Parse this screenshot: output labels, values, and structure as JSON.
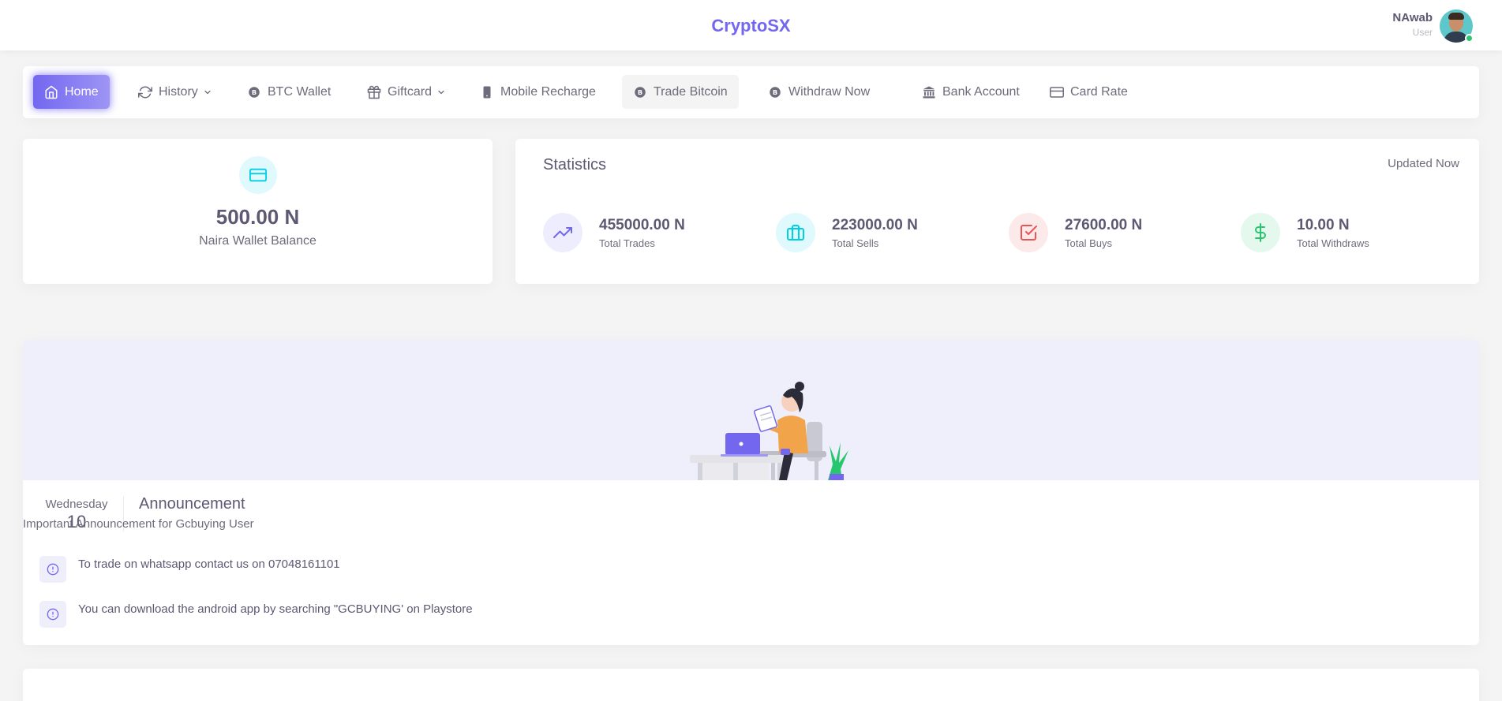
{
  "header": {
    "brand": "CryptoSX",
    "user_name": "NAwab",
    "user_role": "User"
  },
  "nav": {
    "items": [
      {
        "label": "Home",
        "icon": "home-icon",
        "active": true
      },
      {
        "label": "History",
        "icon": "refresh-icon",
        "dropdown": true
      },
      {
        "label": "BTC Wallet",
        "icon": "bitcoin-icon"
      },
      {
        "label": "Giftcard",
        "icon": "gift-icon",
        "dropdown": true
      },
      {
        "label": "Mobile Recharge",
        "icon": "smartphone-icon"
      },
      {
        "label": "Trade Bitcoin",
        "icon": "bitcoin-icon",
        "hovered": true
      },
      {
        "label": "Withdraw Now",
        "icon": "bitcoin-icon"
      },
      {
        "label": "Bank Account",
        "icon": "bank-icon"
      },
      {
        "label": "Card Rate",
        "icon": "credit-card-icon"
      }
    ]
  },
  "wallet": {
    "amount": "500.00 N",
    "label": "Naira Wallet Balance",
    "icon": "credit-card-icon"
  },
  "statistics": {
    "title": "Statistics",
    "updated": "Updated Now",
    "items": [
      {
        "value": "455000.00 N",
        "label": "Total Trades",
        "icon": "trending-up-icon",
        "color": "#7367f0",
        "bg": "#eeedfd"
      },
      {
        "value": "223000.00 N",
        "label": "Total Sells",
        "icon": "briefcase-icon",
        "color": "#00cfe8",
        "bg": "#e0f9fc"
      },
      {
        "value": "27600.00 N",
        "label": "Total Buys",
        "icon": "check-square-icon",
        "color": "#ea5455",
        "bg": "#fceaea"
      },
      {
        "value": "10.00 N",
        "label": "Total Withdraws",
        "icon": "dollar-icon",
        "color": "#28c76f",
        "bg": "#e5f8ed"
      }
    ]
  },
  "announcement": {
    "day_name": "Wednesday",
    "day_num": "10",
    "title": "Announcement",
    "subtitle": "Important Announcement for Gcbuying User",
    "items": [
      "To trade on whatsapp contact us on 07048161101",
      "You can download the android app by searching \"GCBUYING' on Playstore"
    ]
  },
  "colors": {
    "primary": "#7367f0",
    "banner_bg": "#efeffc"
  }
}
